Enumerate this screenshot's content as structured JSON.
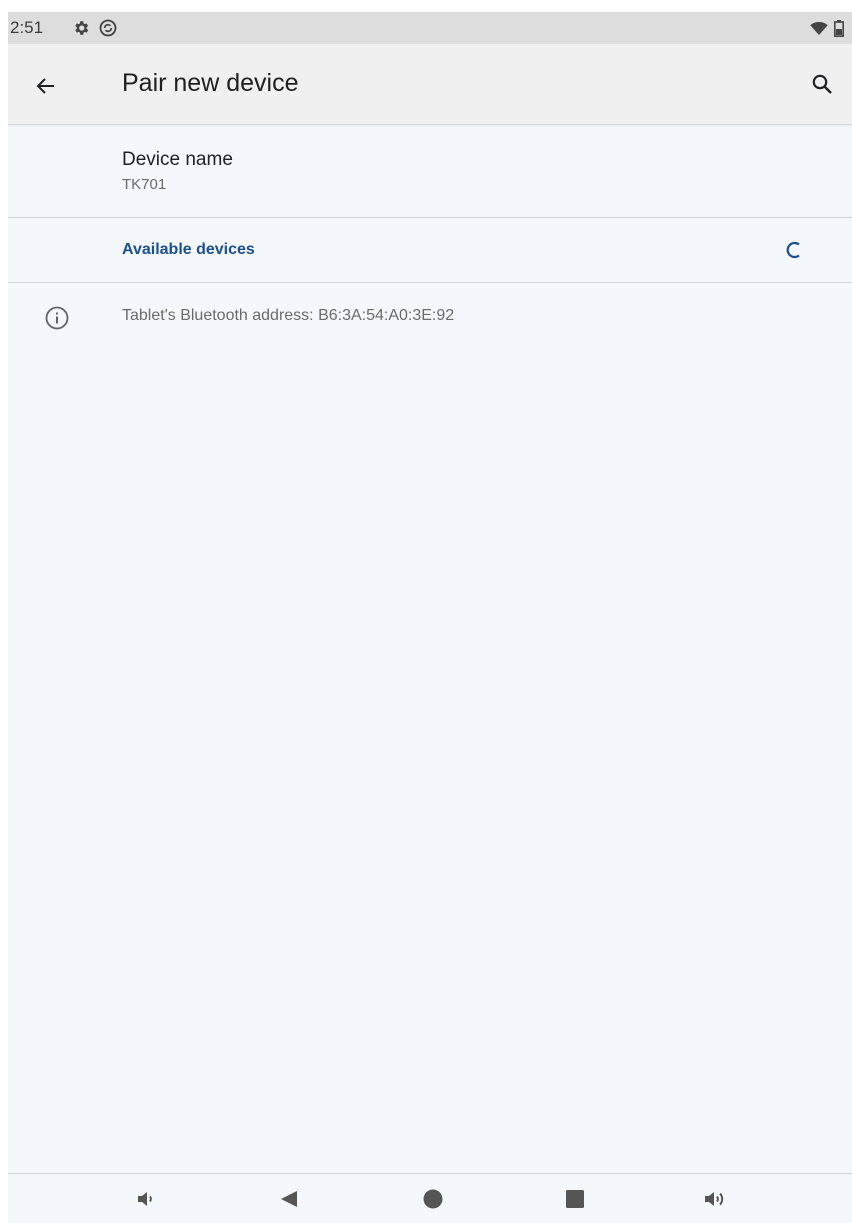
{
  "status_bar": {
    "time": "2:51",
    "icons": [
      "gear-icon",
      "sync-icon",
      "wifi-icon",
      "battery-icon"
    ]
  },
  "app_bar": {
    "title": "Pair new device",
    "back_icon": "arrow-left-icon",
    "search_icon": "search-icon"
  },
  "device_name": {
    "title": "Device name",
    "value": "TK701"
  },
  "available_devices": {
    "label": "Available devices",
    "status_icon": "loading-spinner-icon"
  },
  "info": {
    "icon": "info-icon",
    "text": "Tablet's Bluetooth address: B6:3A:54:A0:3E:92"
  },
  "nav_bar": {
    "buttons": [
      "volume-down-icon",
      "back-triangle-icon",
      "home-circle-icon",
      "recents-square-icon",
      "volume-up-icon"
    ]
  },
  "colors": {
    "accent": "#1d4f8c",
    "background": "#f4f8fc",
    "app_bar": "#f0f0f0",
    "status_bar": "#dddddd"
  }
}
